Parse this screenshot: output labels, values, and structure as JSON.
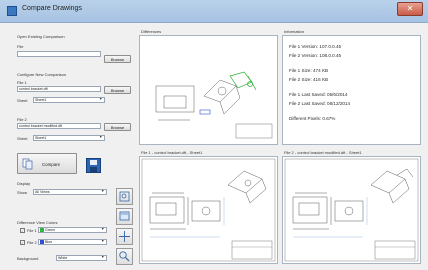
{
  "window": {
    "title": "Compare Drawings",
    "close_glyph": "✕"
  },
  "left": {
    "open_existing_label": "Open Existing Comparison",
    "file_label": "File",
    "browse_label": "Browse",
    "configure_label": "Configure New Comparison",
    "file1_label": "File 1",
    "file1_value": "control bracket.dft",
    "file1_browse": "Browse",
    "sheet1_label": "Sheet",
    "sheet1_value": "Sheet1",
    "file2_label": "File 2",
    "file2_value": "control bracket modified.dft",
    "file2_browse": "Browse",
    "sheet2_label": "Sheet",
    "sheet2_value": "Sheet1",
    "compare_label": "Compare",
    "display_label": "Display",
    "show_label": "Show",
    "show_value": "All Views",
    "diff_colors_label": "Difference View Colors",
    "file1_color_label": "File 1",
    "file1_color_value": "Green",
    "file2_color_label": "File 2",
    "file2_color_value": "Blue",
    "background_label": "Background",
    "background_value": "White",
    "check_glyph": "✓"
  },
  "panels": {
    "differences_title": "Differences",
    "information_title": "Information",
    "file1_sheet_title": "File 1 - control bracket.dft - Sheet1",
    "file2_sheet_title": "File 2 - control bracket modified.dft - Sheet1"
  },
  "information": {
    "file1_version": "File 1 Version: 107.0.0.45",
    "file2_version": "File 2 Version: 108.0.0.45",
    "file1_size": "File 1 Size: 474 KB",
    "file2_size": "File 2 Size: 416 KB",
    "file1_saved": "File 1 Last Saved: 05/6/2014",
    "file2_saved": "File 2 Last Saved: 06/12/2014",
    "differences": "Different Pixels: 0.67%"
  },
  "colors": {
    "file1": "#2fb53a",
    "file2": "#2c4fd6",
    "background": "#ffffff"
  },
  "icons": {
    "save": "save-icon",
    "compare": "compare-icon",
    "zoom_fit": "zoom-fit-icon",
    "zoom_window": "zoom-window-icon",
    "pan": "pan-icon",
    "zoom": "zoom-icon"
  }
}
